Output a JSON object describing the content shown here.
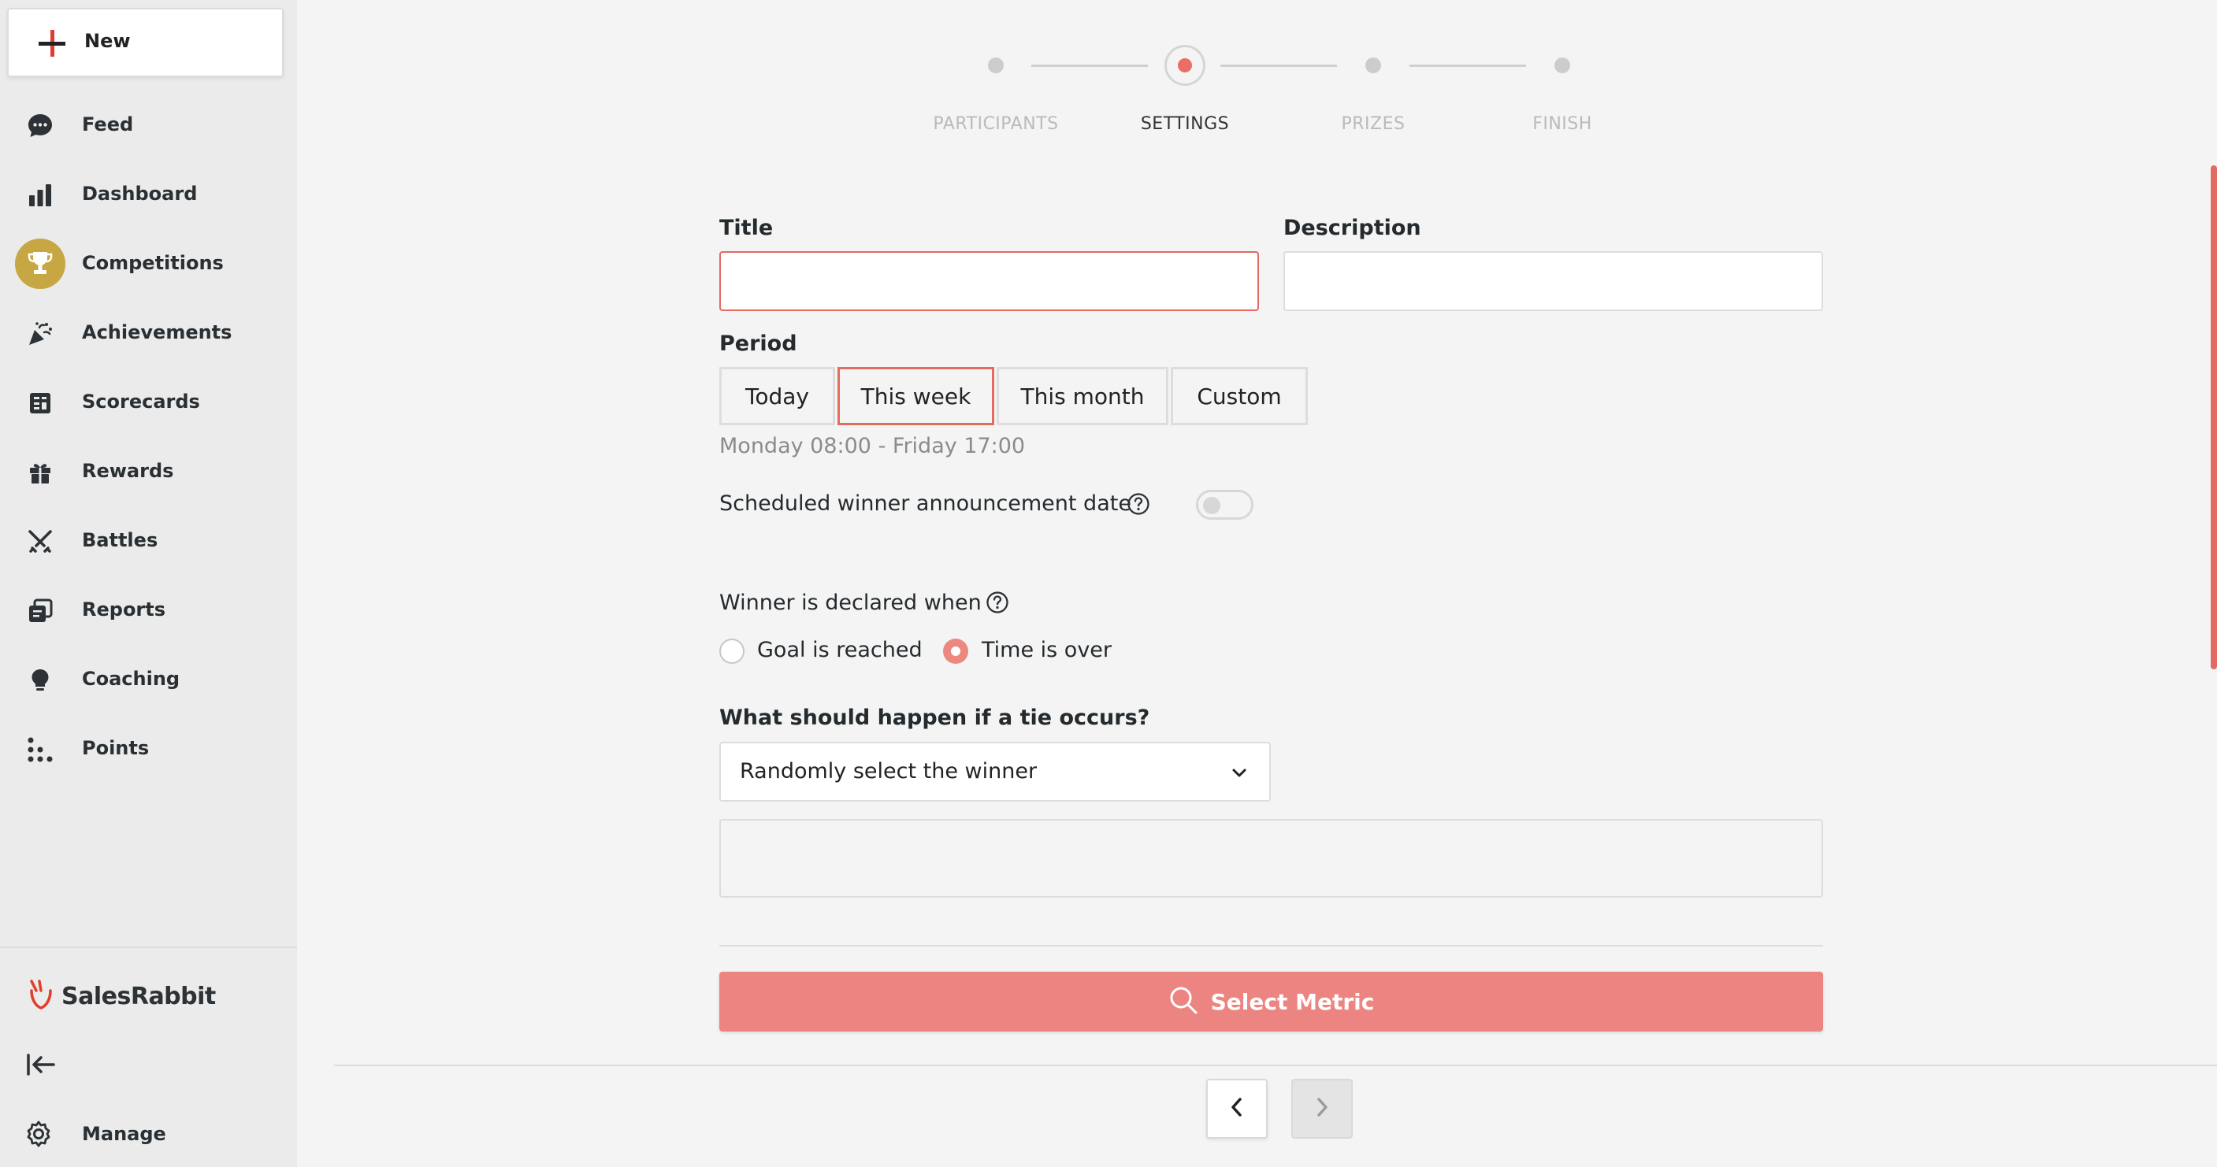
{
  "sidebar": {
    "new_label": "New",
    "items": [
      {
        "label": "Feed",
        "icon": "chat-bubble-icon"
      },
      {
        "label": "Dashboard",
        "icon": "bar-chart-icon"
      },
      {
        "label": "Competitions",
        "icon": "trophy-icon",
        "active": true
      },
      {
        "label": "Achievements",
        "icon": "party-popper-icon"
      },
      {
        "label": "Scorecards",
        "icon": "scorecard-icon"
      },
      {
        "label": "Rewards",
        "icon": "gift-icon"
      },
      {
        "label": "Battles",
        "icon": "crossed-swords-icon"
      },
      {
        "label": "Reports",
        "icon": "reports-icon"
      },
      {
        "label": "Coaching",
        "icon": "lightbulb-icon"
      },
      {
        "label": "Points",
        "icon": "dots-grid-icon"
      }
    ],
    "brand": "SalesRabbit",
    "manage_label": "Manage"
  },
  "stepper": {
    "steps": [
      "PARTICIPANTS",
      "SETTINGS",
      "PRIZES",
      "FINISH"
    ],
    "current": "SETTINGS"
  },
  "form": {
    "title_label": "Title",
    "title_value": "",
    "description_label": "Description",
    "description_value": "",
    "period_label": "Period",
    "period_options": [
      "Today",
      "This week",
      "This month",
      "Custom"
    ],
    "period_selected": "This week",
    "period_hint": "Monday 08:00 - Friday 17:00",
    "scheduled_label": "Scheduled winner announcement date",
    "scheduled_enabled": false,
    "winner_label": "Winner is declared when",
    "winner_options": [
      "Goal is reached",
      "Time is over"
    ],
    "winner_selected": "Time is over",
    "tie_label": "What should happen if a tie occurs?",
    "tie_value": "Randomly select the winner",
    "select_metric_label": "Select Metric"
  },
  "colors": {
    "accent": "#ea6e66",
    "active_nav": "#c7a644",
    "button_primary": "#ec8581"
  }
}
